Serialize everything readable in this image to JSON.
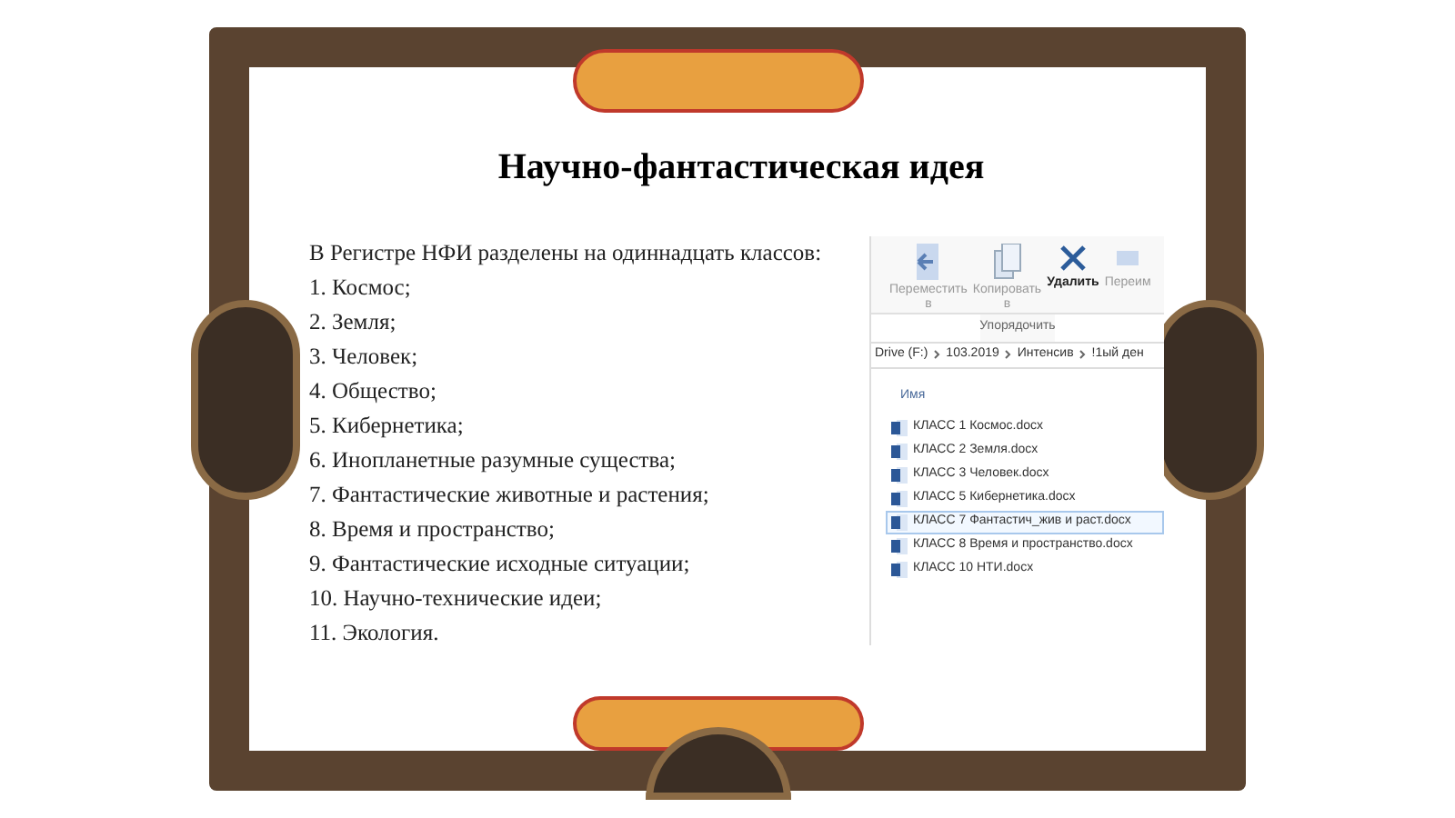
{
  "slide": {
    "title": "Научно-фантастическая идея",
    "intro": "В Регистре НФИ разделены на одиннадцать классов:",
    "items": [
      "1. Космос;",
      "2. Земля;",
      "3. Человек;",
      "4. Общество;",
      "5. Кибернетика;",
      "6. Инопланетные разумные существа;",
      "7. Фантастические животные и растения;",
      "8. Время и пространство;",
      "9. Фантастические исходные ситуации;",
      "10. Научно-технические идеи;",
      "11. Экология."
    ]
  },
  "explorer": {
    "ribbon_buttons": [
      {
        "kind": "move",
        "label": "Переместить\nв"
      },
      {
        "kind": "copy",
        "label": "Копировать\nв"
      },
      {
        "kind": "delete",
        "label": "Удалить"
      },
      {
        "kind": "rename",
        "label": "Переим"
      }
    ],
    "ribbon_group": "Упорядочить",
    "breadcrumb": [
      "Drive (F:)",
      "103.2019",
      "Интенсив",
      "!1ый ден"
    ],
    "column": "Имя",
    "files": [
      {
        "name": "КЛАСС 1 Космос.docx",
        "selected": false
      },
      {
        "name": "КЛАСС 2 Земля.docx",
        "selected": false
      },
      {
        "name": "КЛАСС 3 Человек.docx",
        "selected": false
      },
      {
        "name": "КЛАСС 5 Кибернетика.docx",
        "selected": false
      },
      {
        "name": "КЛАСС 7 Фантастич_жив и раст.docx",
        "selected": true
      },
      {
        "name": "КЛАСС 8 Время и пространство.docx",
        "selected": false
      },
      {
        "name": "КЛАСС 10 НТИ.docx",
        "selected": false
      }
    ]
  }
}
